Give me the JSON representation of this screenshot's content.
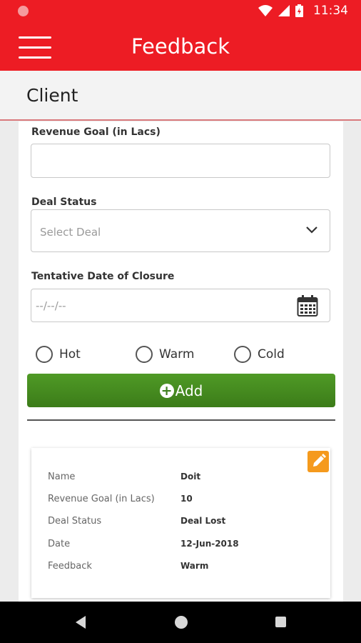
{
  "status_bar": {
    "time": "11:34",
    "icons": [
      "wifi-icon",
      "signal-icon",
      "battery-icon"
    ]
  },
  "app_bar": {
    "title": "Feedback",
    "menu_icon": "hamburger-menu-icon",
    "color": "#ed1c24"
  },
  "section": {
    "title": "Client"
  },
  "form": {
    "revenue_goal": {
      "label": "Revenue Goal (in Lacs)",
      "value": ""
    },
    "deal_status": {
      "label": "Deal Status",
      "placeholder": "Select Deal"
    },
    "closure_date": {
      "label": "Tentative Date of Closure",
      "placeholder": "--/--/--"
    },
    "temperature": {
      "options": [
        "Hot",
        "Warm",
        "Cold"
      ],
      "selected": null
    },
    "add_button": {
      "label": "Add",
      "icon": "plus-circle-icon",
      "color": "#4a8f22"
    }
  },
  "record": {
    "edit_icon": "pencil-icon",
    "rows": [
      {
        "key": "Name",
        "value": "Doit"
      },
      {
        "key": "Revenue Goal (in Lacs)",
        "value": "10"
      },
      {
        "key": "Deal Status",
        "value": "Deal Lost"
      },
      {
        "key": "Date",
        "value": "12-Jun-2018"
      },
      {
        "key": "Feedback",
        "value": "Warm"
      }
    ]
  },
  "nav_bar": {
    "buttons": [
      "back-icon",
      "home-icon",
      "recents-icon"
    ]
  }
}
